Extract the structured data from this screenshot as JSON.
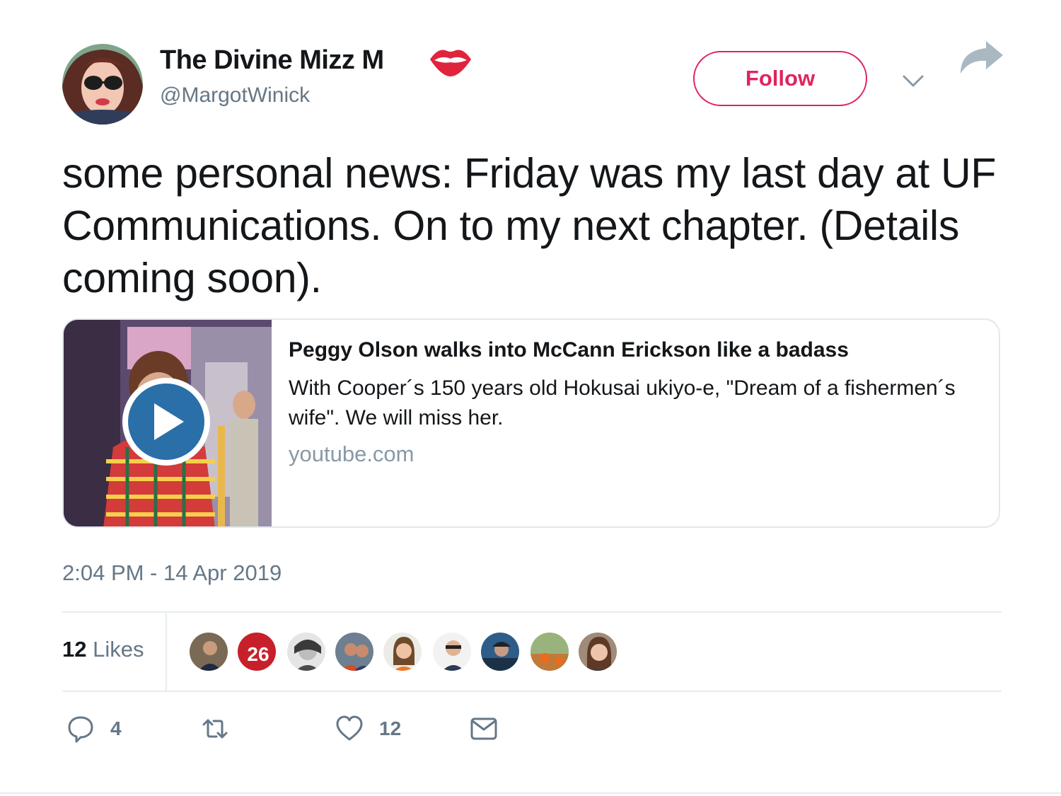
{
  "author": {
    "display_name": "The Divine Mizz M",
    "handle": "@MargotWinick",
    "name_emoji": "lips-icon"
  },
  "header": {
    "follow_label": "Follow",
    "accent_color": "#e0245e"
  },
  "tweet": {
    "text": "some personal news: Friday was my last day at UF Communications. On to my next chapter. (Details coming soon).",
    "timestamp": "2:04 PM - 14 Apr 2019"
  },
  "card": {
    "title": "Peggy Olson walks into McCann Erickson like a badass",
    "description": "With Cooper´s 150 years old Hokusai ukiyo-e, \"Dream of a fishermen´s wife\". We will miss her.",
    "domain": "youtube.com",
    "media_icon": "play-icon"
  },
  "likes": {
    "count": "12",
    "label": " Likes",
    "liker_badge": "26"
  },
  "actions": {
    "reply_count": "4",
    "retweet_count": "",
    "like_count": "12"
  }
}
